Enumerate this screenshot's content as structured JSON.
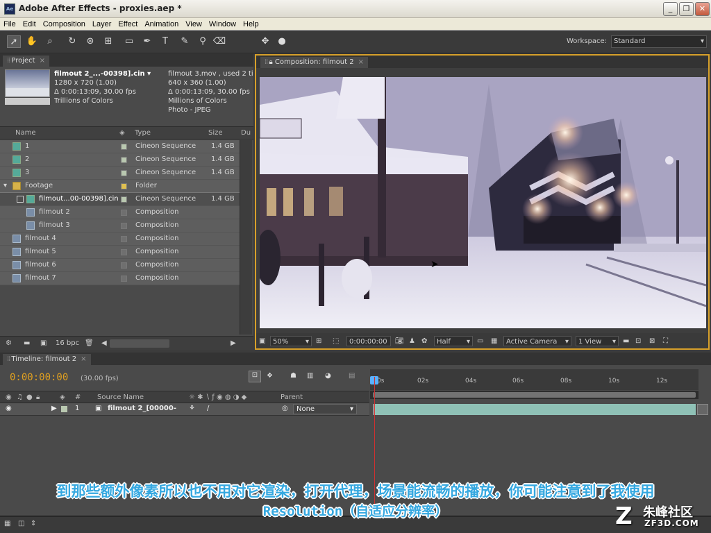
{
  "window": {
    "title": "Adobe After Effects - proxies.aep *",
    "minimize": "_",
    "maximize": "❐",
    "close": "✕"
  },
  "menu": [
    "File",
    "Edit",
    "Composition",
    "Layer",
    "Effect",
    "Animation",
    "View",
    "Window",
    "Help"
  ],
  "workspace": {
    "label": "Workspace:",
    "value": "Standard"
  },
  "project": {
    "tab": "Project",
    "selected": {
      "name": "filmout 2_...-00398].cin ▾",
      "line1": "1280 x 720 (1.00)",
      "line2": "Δ 0:00:13:09, 30.00 fps",
      "line3": "Trillions of Colors"
    },
    "proxy": {
      "name": "filmout 3.mov , used 2 ti",
      "line1": "640 x 360 (1.00)",
      "line2": "Δ 0:00:13:09, 30.00 fps",
      "line3": "Millions of Colors",
      "line4": "Photo - JPEG"
    },
    "columns": {
      "name": "Name",
      "type": "Type",
      "size": "Size",
      "dur": "Du"
    },
    "rows": [
      {
        "name": "1",
        "type": "Cineon Sequence",
        "size": "1.4 GB"
      },
      {
        "name": "2",
        "type": "Cineon Sequence",
        "size": "1.4 GB"
      },
      {
        "name": "3",
        "type": "Cineon Sequence",
        "size": "1.4 GB"
      },
      {
        "name": "Footage",
        "type": "Folder",
        "size": ""
      },
      {
        "name": "filmout...00-00398].cin",
        "type": "Cineon Sequence",
        "size": "1.4 GB"
      },
      {
        "name": "filmout 2",
        "type": "Composition",
        "size": ""
      },
      {
        "name": "filmout 3",
        "type": "Composition",
        "size": ""
      },
      {
        "name": "filmout 4",
        "type": "Composition",
        "size": ""
      },
      {
        "name": "filmout 5",
        "type": "Composition",
        "size": ""
      },
      {
        "name": "filmout 6",
        "type": "Composition",
        "size": ""
      },
      {
        "name": "filmout 7",
        "type": "Composition",
        "size": ""
      }
    ],
    "bpc": "16 bpc"
  },
  "composition": {
    "tab": "Composition: filmout 2",
    "zoom": "50%",
    "timecode": "0:00:00:00",
    "resolution": "Half",
    "camera": "Active Camera",
    "view": "1 View"
  },
  "timeline": {
    "tab": "Timeline: filmout 2",
    "current_time": "0:00:00:00",
    "fps": "(30.00 fps)",
    "col_num": "#",
    "col_source": "Source Name",
    "col_parent": "Parent",
    "ticks": [
      "0s",
      "02s",
      "04s",
      "06s",
      "08s",
      "10s",
      "12s"
    ],
    "layer": {
      "index": "1",
      "name": "filmout 2_[00000-",
      "parent": "None"
    }
  },
  "subtitles": {
    "line1": "到那些额外像素所以也不用对它渲染，打开代理，场景能流畅的播放，你可能注意到了我使用",
    "line2": "Resolution（自适应分辨率）"
  },
  "watermark": {
    "mark": "Z",
    "cn": "朱峰社区",
    "en": "ZF3D.COM"
  }
}
